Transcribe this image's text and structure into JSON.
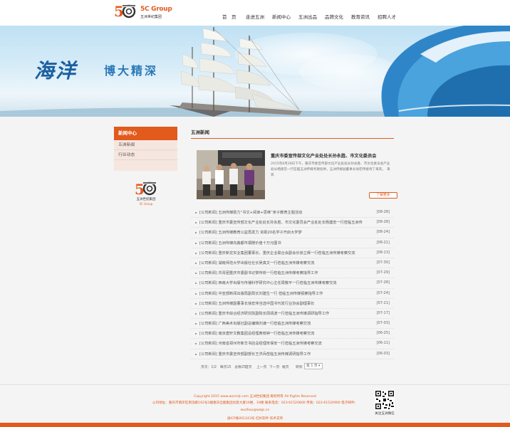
{
  "header": {
    "brand": "5C Group",
    "brand_sub": "五洲世纪集团",
    "nav": [
      "首　页",
      "走进五洲",
      "新闻中心",
      "五洲出品",
      "品牌文化",
      "教育资讯",
      "招聘人才"
    ]
  },
  "banner": {
    "title_big": "海洋",
    "title_sub": "博大精深"
  },
  "sidebar": {
    "title": "新闻中心",
    "items": [
      "五洲新闻",
      "行业动态"
    ],
    "logo_text": "五洲世纪集团",
    "logo_sub": "5C Group"
  },
  "main": {
    "title": "五洲新闻",
    "featured": {
      "title": "重庆市委宣传部文化产业处处长孙永胜、市文化委员会",
      "summary": "2015年8月28日下午，重庆市委宣传部文化产业处处长孙永胜、市文化委员会产业处长杨建忠一行在临五洲传媒考察指导，五洲传媒副董事长徐宏伟接待了来宾。　来宾",
      "more": "了解更多"
    },
    "news": [
      {
        "title": "[公司新闻] 五洲传媒助力“书文+阅读+思维”亲子教育主题活动",
        "date": "[08-28]"
      },
      {
        "title": "[公司新闻] 重庆市委宣传部文化产业处处长孙永胜、市文化委员会产业处处长杨建忠一行莅临五洲传",
        "date": "[08-28]"
      },
      {
        "title": "[公司新闻] 五洲传媒教育公益再发力 资助20名学子开启大学梦",
        "date": "[08-24]"
      },
      {
        "title": "[公司新闻] 五洲传媒向鑫都市捐赠价值十万元图书",
        "date": "[08-21]"
      },
      {
        "title": "[公司新闻] 重庆新龙实业集团董事长、重庆企业联合会副会长徐立辉一行莅临五洲传媒考察交流",
        "date": "[08-13]"
      },
      {
        "title": "[公司新闻] 湖南师范大学出版社社长吴真文一行莅临五洲传媒考察交流",
        "date": "[07-30]"
      },
      {
        "title": "[公司新闻] 共青团重庆市委副书记黎传彬一行莅临五洲传媒考察指导工作",
        "date": "[07-29]"
      },
      {
        "title": "[公司新闻] 西南大学出版与传播科学研究中心主任周敬平一行莅临五洲传媒考察交流",
        "date": "[07-28]"
      },
      {
        "title": "[公司新闻] 中宣部新闻出版局副局长刘建生一行 莅临五洲传媒视察指导工作",
        "date": "[07-24]"
      },
      {
        "title": "[公司新闻] 五洲传媒副董事长徐宏伟当选中国书刊发行业协会副理事长",
        "date": "[07-21]"
      },
      {
        "title": "[公司新闻] 重庆市综合经济研究院副院长周靖波一行莅临五洲传媒调研指导工作",
        "date": "[07-17]"
      },
      {
        "title": "[公司新闻] 广西美术出版社副总编辑刘谦一行莅临五洲传媒考察交流",
        "date": "[07-03]"
      },
      {
        "title": "[公司新闻] 南京唐轩文教集团总经理黄晓钟一行莅临五洲传媒考察交流",
        "date": "[06-25]"
      },
      {
        "title": "[公司新闻] 河南省郑州市新华书店总经理宋保安一行莅临五洲传媒考察交流",
        "date": "[06-11]"
      },
      {
        "title": "[公司新闻] 重庆市委宣传部副部长王洪兵莅临五洲传媒调研指导工作",
        "date": "[06-03]"
      }
    ],
    "pager": {
      "info": "页次：1/2　每页15　总数25",
      "first": "首页",
      "prev": "上一页",
      "next": "下一页",
      "last": "尾页",
      "jump": "转到",
      "select": "第 1 页"
    }
  },
  "footer": {
    "copyright": "Copyright 2015 www.wzcmjt.com 五洲世纪集团 版权所有 All Rights Reserved",
    "address": "公司地址：重庆市南岸区南滨路162号1幢重庆出版集团创意大厦16楼、19楼 联系电话：023-61520800 传真：023-61520900 电子邮件：",
    "email": "wuzhou@wzgs.cn",
    "icp": "渝ICP备001243号  红杉软件 技术支持",
    "qr_label": "关注五洲微信"
  }
}
